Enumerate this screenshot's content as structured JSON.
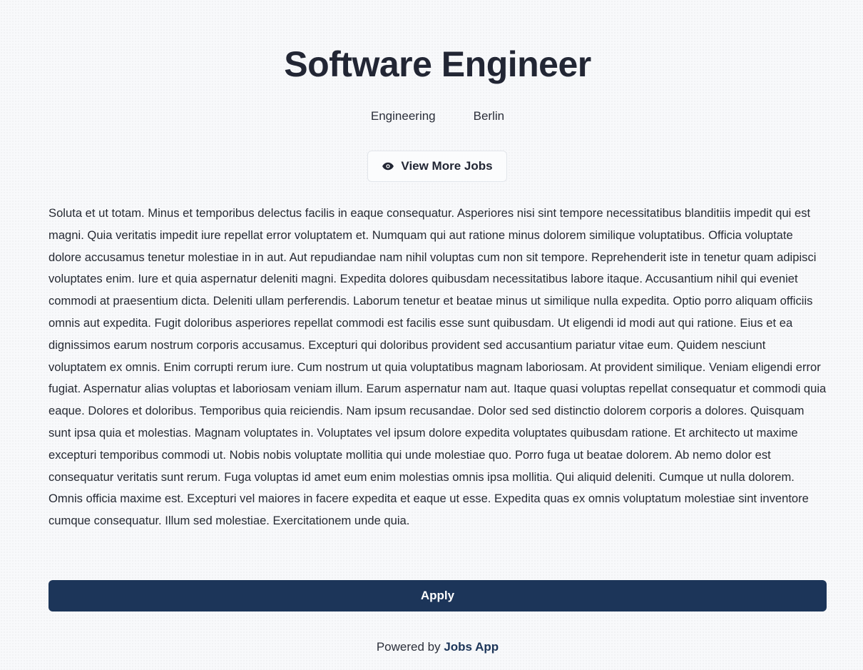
{
  "job": {
    "title": "Software Engineer",
    "department": "Engineering",
    "location": "Berlin",
    "description": "Soluta et ut totam. Minus et temporibus delectus facilis in eaque consequatur. Asperiores nisi sint tempore necessitatibus blanditiis impedit qui est magni. Quia veritatis impedit iure repellat error voluptatem et. Numquam qui aut ratione minus dolorem similique voluptatibus. Officia voluptate dolore accusamus tenetur molestiae in in aut. Aut repudiandae nam nihil voluptas cum non sit tempore. Reprehenderit iste in tenetur quam adipisci voluptates enim. Iure et quia aspernatur deleniti magni. Expedita dolores quibusdam necessitatibus labore itaque. Accusantium nihil qui eveniet commodi at praesentium dicta. Deleniti ullam perferendis. Laborum tenetur et beatae minus ut similique nulla expedita. Optio porro aliquam officiis omnis aut expedita. Fugit doloribus asperiores repellat commodi est facilis esse sunt quibusdam. Ut eligendi id modi aut qui ratione. Eius et ea dignissimos earum nostrum corporis accusamus. Excepturi qui doloribus provident sed accusantium pariatur vitae eum. Quidem nesciunt voluptatem ex omnis. Enim corrupti rerum iure. Cum nostrum ut quia voluptatibus magnam laboriosam. At provident similique. Veniam eligendi error fugiat. Aspernatur alias voluptas et laboriosam veniam illum. Earum aspernatur nam aut. Itaque quasi voluptas repellat consequatur et commodi quia eaque. Dolores et doloribus. Temporibus quia reiciendis. Nam ipsum recusandae. Dolor sed sed distinctio dolorem corporis a dolores. Quisquam sunt ipsa quia et molestias. Magnam voluptates in. Voluptates vel ipsum dolore expedita voluptates quibusdam ratione. Et architecto ut maxime excepturi temporibus commodi ut. Nobis nobis voluptate mollitia qui unde molestiae quo. Porro fuga ut beatae dolorem. Ab nemo dolor est consequatur veritatis sunt rerum. Fuga voluptas id amet eum enim molestias omnis ipsa mollitia. Qui aliquid deleniti. Cumque ut nulla dolorem. Omnis officia maxime est. Excepturi vel maiores in facere expedita et eaque ut esse. Expedita quas ex omnis voluptatum molestiae sint inventore cumque consequatur. Illum sed molestiae. Exercitationem unde quia."
  },
  "actions": {
    "view_more_label": "View More Jobs",
    "view_more_icon": "eye-icon",
    "apply_label": "Apply"
  },
  "footer": {
    "prefix": "Powered by",
    "brand": "Jobs App"
  },
  "colors": {
    "primary": "#1c3559",
    "background": "#f8f9fb",
    "text": "#222634"
  }
}
